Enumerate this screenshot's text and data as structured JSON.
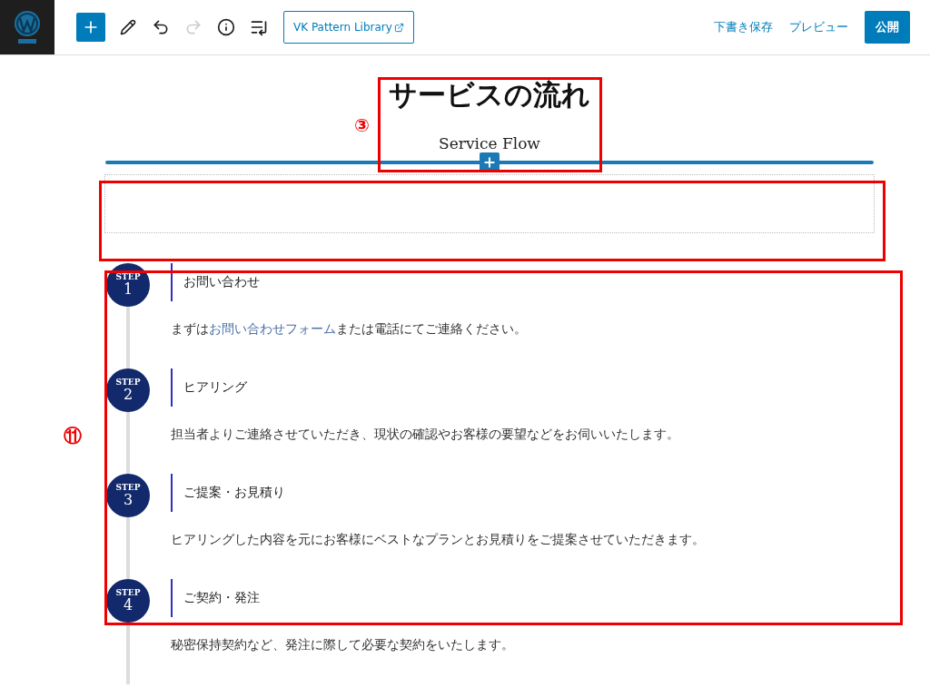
{
  "toolbar": {
    "tools": [
      {
        "kind": "add",
        "disabled": false
      },
      {
        "kind": "edit",
        "disabled": false
      },
      {
        "kind": "undo",
        "disabled": false
      },
      {
        "kind": "redo",
        "disabled": true
      },
      {
        "kind": "info",
        "disabled": false
      },
      {
        "kind": "outline",
        "disabled": false
      }
    ],
    "pattern_library": "VK Pattern Library",
    "save_draft": "下書き保存",
    "preview": "プレビュー",
    "publish": "公開"
  },
  "heading": {
    "title": "サービスの流れ",
    "subtitle": "Service Flow"
  },
  "steps": [
    {
      "label": "STEP",
      "number": "1",
      "title": "お問い合わせ",
      "text": [
        {
          "kind": "plain",
          "text": "まずは"
        },
        {
          "kind": "link",
          "text": "お問い合わせフォーム"
        },
        {
          "kind": "plain",
          "text": "または電話にてご連絡ください。"
        }
      ]
    },
    {
      "label": "STEP",
      "number": "2",
      "title": "ヒアリング",
      "text": [
        {
          "kind": "plain",
          "text": "担当者よりご連絡させていただき、現状の確認やお客様の要望などをお伺いいたします。"
        }
      ]
    },
    {
      "label": "STEP",
      "number": "3",
      "title": "ご提案・お見積り",
      "text": [
        {
          "kind": "plain",
          "text": "ヒアリングした内容を元にお客様にベストなプランとお見積りをご提案させていただきます。"
        }
      ]
    },
    {
      "label": "STEP",
      "number": "4",
      "title": "ご契約・発注",
      "text": [
        {
          "kind": "plain",
          "text": "秘密保持契約など、発注に際して必要な契約をいたします。"
        }
      ]
    }
  ],
  "annotations": [
    {
      "label": "③"
    },
    {
      "label": "⑪"
    }
  ]
}
